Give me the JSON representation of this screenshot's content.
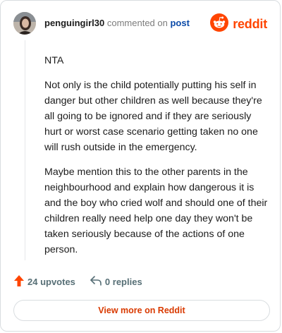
{
  "comment": {
    "username": "penguingirl30",
    "action_text": "commented on",
    "post_link": "post",
    "paragraphs": [
      "NTA",
      "Not only is the child potentially putting his self in danger but other children as well because they're all going to be ignored and if they are seriously hurt or worst case scenario getting taken no one will rush outside in the emergency.",
      "Maybe mention this to the other parents in the neighbourhood and explain how dangerous it is and the boy who cried wolf and should one of their children really need help one day they won't be taken seriously because of the actions of one person."
    ]
  },
  "brand": {
    "name": "reddit",
    "icon": "reddit-alien-icon",
    "color": "#ff4500"
  },
  "stats": {
    "upvotes": "24 upvotes",
    "replies": "0 replies",
    "upvote_icon": "upvote-arrow-icon",
    "reply_icon": "reply-arrow-icon"
  },
  "footer": {
    "view_more_label": "View more on Reddit"
  }
}
